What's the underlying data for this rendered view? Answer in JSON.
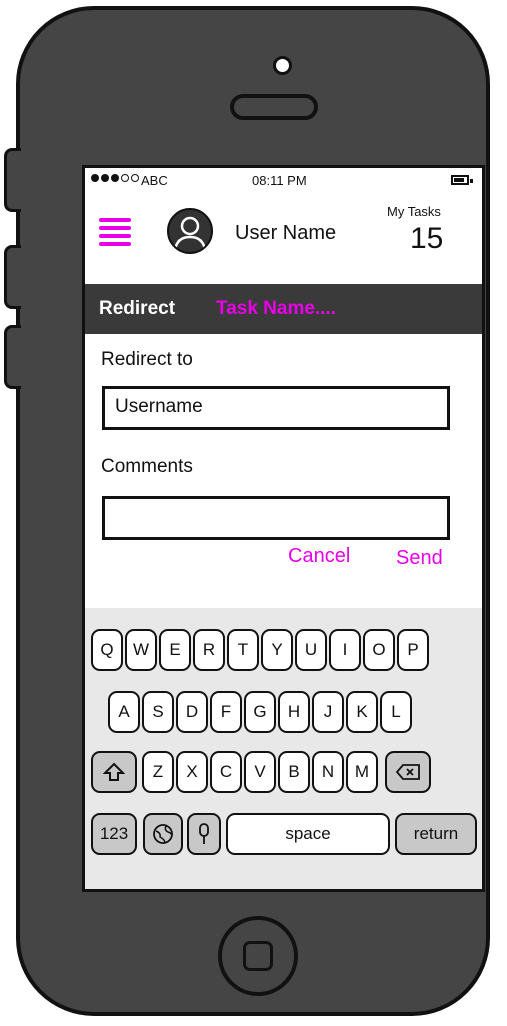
{
  "status_bar": {
    "carrier": "ABC",
    "time": "08:11 PM"
  },
  "header": {
    "user_name": "User Name",
    "my_tasks_label": "My Tasks",
    "my_tasks_count": "15"
  },
  "task_bar": {
    "action": "Redirect",
    "task_name": "Task Name...."
  },
  "form": {
    "redirect_to_label": "Redirect to",
    "username_value": "Username",
    "comments_label": "Comments",
    "comments_value": "",
    "cancel_label": "Cancel",
    "send_label": "Send"
  },
  "keyboard": {
    "row1": [
      "Q",
      "W",
      "E",
      "R",
      "T",
      "Y",
      "U",
      "I",
      "O",
      "P"
    ],
    "row2": [
      "A",
      "S",
      "D",
      "F",
      "G",
      "H",
      "J",
      "K",
      "L"
    ],
    "row3": [
      "Z",
      "X",
      "C",
      "V",
      "B",
      "N",
      "M"
    ],
    "numbers_label": "123",
    "space_label": "space",
    "return_label": "return"
  },
  "icons": {
    "menu": "hamburger-icon",
    "avatar": "user-avatar-icon",
    "shift": "shift-arrow-icon",
    "backspace": "backspace-icon",
    "globe": "globe-icon",
    "mic": "microphone-icon",
    "battery": "battery-icon"
  },
  "colors": {
    "accent": "#e800e8",
    "task_bar": "#3a3a3a",
    "phone_body": "#454545"
  }
}
